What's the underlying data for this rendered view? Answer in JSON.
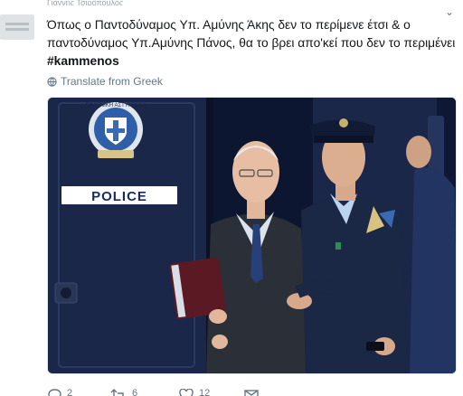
{
  "header": {
    "author_name": "Γιάννης Τσιρόπουλος"
  },
  "tweet": {
    "text": "Όπως ο Παντοδύναμος Υπ. Αμύνης Άκης δεν το περίμενε έτσι & ο παντοδύναμος Υπ.Αμύνης Πάνος, θα το βρει απο'κεί που δεν το περιμένει",
    "hashtag": "#kammenos",
    "translate_label": "Translate from Greek"
  },
  "photo": {
    "sign_text": "POLICE",
    "emblem_text": "ΕΛΛΗΝΙΚΗ ΑΣΤΥΝΟΜΙΑ"
  },
  "actions": {
    "replies": "2",
    "retweets": "6",
    "likes": "12"
  },
  "colors": {
    "text": "#14171a",
    "muted": "#657786",
    "van": "#17223e",
    "uniform": "#1a2745"
  }
}
